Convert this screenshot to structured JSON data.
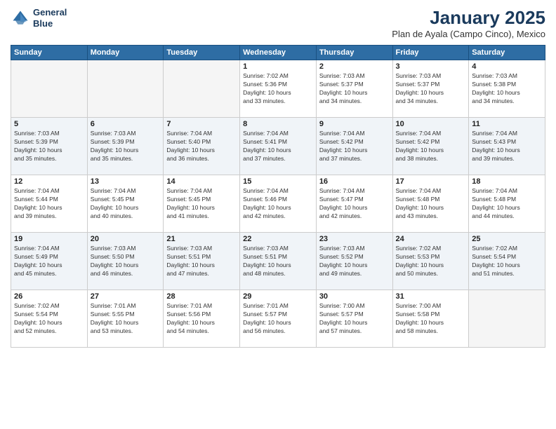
{
  "header": {
    "logo_line1": "General",
    "logo_line2": "Blue",
    "month": "January 2025",
    "location": "Plan de Ayala (Campo Cinco), Mexico"
  },
  "weekdays": [
    "Sunday",
    "Monday",
    "Tuesday",
    "Wednesday",
    "Thursday",
    "Friday",
    "Saturday"
  ],
  "weeks": [
    [
      {
        "day": "",
        "info": ""
      },
      {
        "day": "",
        "info": ""
      },
      {
        "day": "",
        "info": ""
      },
      {
        "day": "1",
        "info": "Sunrise: 7:02 AM\nSunset: 5:36 PM\nDaylight: 10 hours\nand 33 minutes."
      },
      {
        "day": "2",
        "info": "Sunrise: 7:03 AM\nSunset: 5:37 PM\nDaylight: 10 hours\nand 34 minutes."
      },
      {
        "day": "3",
        "info": "Sunrise: 7:03 AM\nSunset: 5:37 PM\nDaylight: 10 hours\nand 34 minutes."
      },
      {
        "day": "4",
        "info": "Sunrise: 7:03 AM\nSunset: 5:38 PM\nDaylight: 10 hours\nand 34 minutes."
      }
    ],
    [
      {
        "day": "5",
        "info": "Sunrise: 7:03 AM\nSunset: 5:39 PM\nDaylight: 10 hours\nand 35 minutes."
      },
      {
        "day": "6",
        "info": "Sunrise: 7:03 AM\nSunset: 5:39 PM\nDaylight: 10 hours\nand 35 minutes."
      },
      {
        "day": "7",
        "info": "Sunrise: 7:04 AM\nSunset: 5:40 PM\nDaylight: 10 hours\nand 36 minutes."
      },
      {
        "day": "8",
        "info": "Sunrise: 7:04 AM\nSunset: 5:41 PM\nDaylight: 10 hours\nand 37 minutes."
      },
      {
        "day": "9",
        "info": "Sunrise: 7:04 AM\nSunset: 5:42 PM\nDaylight: 10 hours\nand 37 minutes."
      },
      {
        "day": "10",
        "info": "Sunrise: 7:04 AM\nSunset: 5:42 PM\nDaylight: 10 hours\nand 38 minutes."
      },
      {
        "day": "11",
        "info": "Sunrise: 7:04 AM\nSunset: 5:43 PM\nDaylight: 10 hours\nand 39 minutes."
      }
    ],
    [
      {
        "day": "12",
        "info": "Sunrise: 7:04 AM\nSunset: 5:44 PM\nDaylight: 10 hours\nand 39 minutes."
      },
      {
        "day": "13",
        "info": "Sunrise: 7:04 AM\nSunset: 5:45 PM\nDaylight: 10 hours\nand 40 minutes."
      },
      {
        "day": "14",
        "info": "Sunrise: 7:04 AM\nSunset: 5:45 PM\nDaylight: 10 hours\nand 41 minutes."
      },
      {
        "day": "15",
        "info": "Sunrise: 7:04 AM\nSunset: 5:46 PM\nDaylight: 10 hours\nand 42 minutes."
      },
      {
        "day": "16",
        "info": "Sunrise: 7:04 AM\nSunset: 5:47 PM\nDaylight: 10 hours\nand 42 minutes."
      },
      {
        "day": "17",
        "info": "Sunrise: 7:04 AM\nSunset: 5:48 PM\nDaylight: 10 hours\nand 43 minutes."
      },
      {
        "day": "18",
        "info": "Sunrise: 7:04 AM\nSunset: 5:48 PM\nDaylight: 10 hours\nand 44 minutes."
      }
    ],
    [
      {
        "day": "19",
        "info": "Sunrise: 7:04 AM\nSunset: 5:49 PM\nDaylight: 10 hours\nand 45 minutes."
      },
      {
        "day": "20",
        "info": "Sunrise: 7:03 AM\nSunset: 5:50 PM\nDaylight: 10 hours\nand 46 minutes."
      },
      {
        "day": "21",
        "info": "Sunrise: 7:03 AM\nSunset: 5:51 PM\nDaylight: 10 hours\nand 47 minutes."
      },
      {
        "day": "22",
        "info": "Sunrise: 7:03 AM\nSunset: 5:51 PM\nDaylight: 10 hours\nand 48 minutes."
      },
      {
        "day": "23",
        "info": "Sunrise: 7:03 AM\nSunset: 5:52 PM\nDaylight: 10 hours\nand 49 minutes."
      },
      {
        "day": "24",
        "info": "Sunrise: 7:02 AM\nSunset: 5:53 PM\nDaylight: 10 hours\nand 50 minutes."
      },
      {
        "day": "25",
        "info": "Sunrise: 7:02 AM\nSunset: 5:54 PM\nDaylight: 10 hours\nand 51 minutes."
      }
    ],
    [
      {
        "day": "26",
        "info": "Sunrise: 7:02 AM\nSunset: 5:54 PM\nDaylight: 10 hours\nand 52 minutes."
      },
      {
        "day": "27",
        "info": "Sunrise: 7:01 AM\nSunset: 5:55 PM\nDaylight: 10 hours\nand 53 minutes."
      },
      {
        "day": "28",
        "info": "Sunrise: 7:01 AM\nSunset: 5:56 PM\nDaylight: 10 hours\nand 54 minutes."
      },
      {
        "day": "29",
        "info": "Sunrise: 7:01 AM\nSunset: 5:57 PM\nDaylight: 10 hours\nand 56 minutes."
      },
      {
        "day": "30",
        "info": "Sunrise: 7:00 AM\nSunset: 5:57 PM\nDaylight: 10 hours\nand 57 minutes."
      },
      {
        "day": "31",
        "info": "Sunrise: 7:00 AM\nSunset: 5:58 PM\nDaylight: 10 hours\nand 58 minutes."
      },
      {
        "day": "",
        "info": ""
      }
    ]
  ]
}
